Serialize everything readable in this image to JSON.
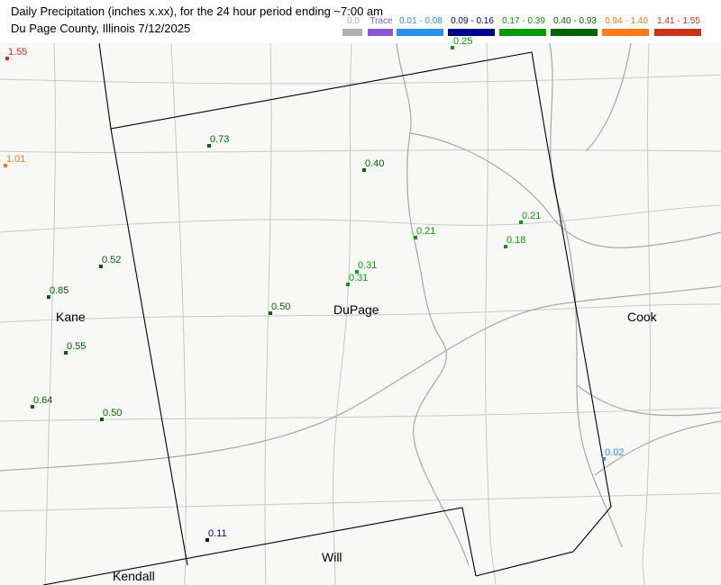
{
  "header": {
    "title": "Daily Precipitation (inches  x.xx),  for the 24 hour period ending ~7:00 am",
    "subtitle": "Du Page County, Illinois  7/12/2025"
  },
  "legend": [
    {
      "label": "0.0",
      "color": "#b0b0b0"
    },
    {
      "label": "Trace",
      "color": "#8a56d8"
    },
    {
      "label": "0.01 - 0.08",
      "color": "#2b8fef"
    },
    {
      "label": "0.09 - 0.16",
      "color": "#00008b"
    },
    {
      "label": "0.17 - 0.39",
      "color": "#0a9a0a"
    },
    {
      "label": "0.40 - 0.93",
      "color": "#006400"
    },
    {
      "label": "0.94 - 1.40",
      "color": "#ff7a18"
    },
    {
      "label": "1.41 - 1.55",
      "color": "#c8341a"
    }
  ],
  "counties": [
    {
      "name": "Kane"
    },
    {
      "name": "DuPage"
    },
    {
      "name": "Cook"
    },
    {
      "name": "Will"
    },
    {
      "name": "Kendall"
    }
  ],
  "stations": [
    {
      "value": "1.55",
      "color": "#c8341a"
    },
    {
      "value": "1.01",
      "color": "#ff7a18"
    },
    {
      "value": "0.25",
      "color": "#0a9a0a"
    },
    {
      "value": "0.73",
      "color": "#006400"
    },
    {
      "value": "0.40",
      "color": "#006400"
    },
    {
      "value": "0.21",
      "color": "#0a9a0a"
    },
    {
      "value": "0.21",
      "color": "#0a9a0a"
    },
    {
      "value": "0.18",
      "color": "#0a9a0a"
    },
    {
      "value": "0.52",
      "color": "#006400"
    },
    {
      "value": "0.85",
      "color": "#006400"
    },
    {
      "value": "0.31",
      "color": "#0a9a0a"
    },
    {
      "value": "0.31",
      "color": "#0a9a0a"
    },
    {
      "value": "0.50",
      "color": "#006400"
    },
    {
      "value": "0.55",
      "color": "#006400"
    },
    {
      "value": "0.64",
      "color": "#006400"
    },
    {
      "value": "0.50",
      "color": "#006400"
    },
    {
      "value": "0.02",
      "color": "#2b8fef"
    },
    {
      "value": "0.11",
      "color": "#00008b"
    }
  ]
}
